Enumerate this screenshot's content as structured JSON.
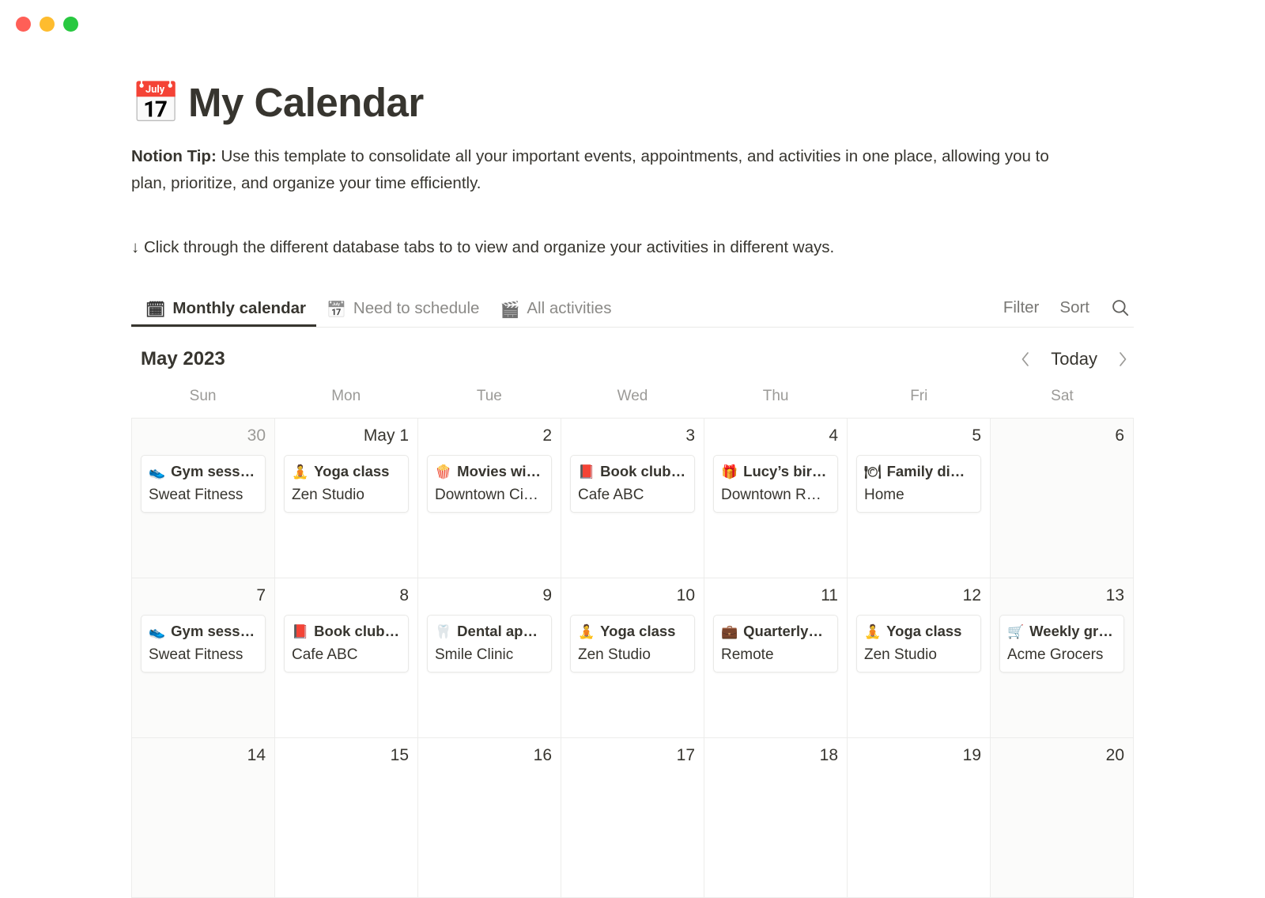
{
  "window": {
    "close_label": "close",
    "minimize_label": "minimize",
    "zoom_label": "zoom"
  },
  "header": {
    "emoji": "📅",
    "title": "My Calendar",
    "tip_label": "Notion Tip:",
    "tip_body": " Use this template to consolidate all your important events, appointments, and activities in one place, allowing you to plan, prioritize, and organize your time efficiently.",
    "hint": "↓ Click through the different database tabs to to view and organize your activities in different ways."
  },
  "tabs": [
    {
      "label": "Monthly calendar",
      "icon": "🗓",
      "active": true
    },
    {
      "label": "Need to schedule",
      "icon": "📅",
      "active": false
    },
    {
      "label": "All activities",
      "icon": "🎬",
      "active": false
    }
  ],
  "tools": {
    "filter_label": "Filter",
    "sort_label": "Sort",
    "search_icon": "search-icon"
  },
  "calendar": {
    "month_label": "May 2023",
    "prev_label": "previous",
    "today_label": "Today",
    "next_label": "next",
    "weekdays": [
      "Sun",
      "Mon",
      "Tue",
      "Wed",
      "Thu",
      "Fri",
      "Sat"
    ],
    "weeks": [
      [
        {
          "num": "30",
          "muted": true,
          "weekend": true,
          "events": [
            {
              "emoji": "👟",
              "title": "Gym sess…",
              "sub": "Sweat Fitness"
            }
          ]
        },
        {
          "num": "May 1",
          "muted": false,
          "weekend": false,
          "events": [
            {
              "emoji": "🧘",
              "title": "Yoga class",
              "sub": "Zen Studio"
            }
          ]
        },
        {
          "num": "2",
          "muted": false,
          "weekend": false,
          "events": [
            {
              "emoji": "🍿",
              "title": "Movies wi…",
              "sub": "Downtown Ci…"
            }
          ]
        },
        {
          "num": "3",
          "muted": false,
          "weekend": false,
          "events": [
            {
              "emoji": "📕",
              "title": "Book club…",
              "sub": "Cafe ABC"
            }
          ]
        },
        {
          "num": "4",
          "muted": false,
          "weekend": false,
          "events": [
            {
              "emoji": "🎁",
              "title": "Lucy’s bir…",
              "sub": "Downtown R…"
            }
          ]
        },
        {
          "num": "5",
          "muted": false,
          "weekend": false,
          "events": [
            {
              "emoji": "🍽",
              "title": "Family di…",
              "sub": "Home"
            }
          ]
        },
        {
          "num": "6",
          "muted": false,
          "weekend": true,
          "events": []
        }
      ],
      [
        {
          "num": "7",
          "muted": false,
          "weekend": true,
          "events": [
            {
              "emoji": "👟",
              "title": "Gym sess…",
              "sub": "Sweat Fitness"
            }
          ]
        },
        {
          "num": "8",
          "muted": false,
          "weekend": false,
          "events": [
            {
              "emoji": "📕",
              "title": "Book club…",
              "sub": "Cafe ABC"
            }
          ]
        },
        {
          "num": "9",
          "muted": false,
          "weekend": false,
          "events": [
            {
              "emoji": "🦷",
              "title": "Dental ap…",
              "sub": "Smile Clinic"
            }
          ]
        },
        {
          "num": "10",
          "muted": false,
          "weekend": false,
          "events": [
            {
              "emoji": "🧘",
              "title": "Yoga class",
              "sub": "Zen Studio"
            }
          ]
        },
        {
          "num": "11",
          "muted": false,
          "weekend": false,
          "events": [
            {
              "emoji": "💼",
              "title": "Quarterly…",
              "sub": "Remote"
            }
          ]
        },
        {
          "num": "12",
          "muted": false,
          "weekend": false,
          "events": [
            {
              "emoji": "🧘",
              "title": "Yoga class",
              "sub": "Zen Studio"
            }
          ]
        },
        {
          "num": "13",
          "muted": false,
          "weekend": true,
          "events": [
            {
              "emoji": "🛒",
              "title": "Weekly gr…",
              "sub": "Acme Grocers"
            }
          ]
        }
      ],
      [
        {
          "num": "14",
          "muted": false,
          "weekend": true,
          "events": []
        },
        {
          "num": "15",
          "muted": false,
          "weekend": false,
          "events": []
        },
        {
          "num": "16",
          "muted": false,
          "weekend": false,
          "events": []
        },
        {
          "num": "17",
          "muted": false,
          "weekend": false,
          "events": []
        },
        {
          "num": "18",
          "muted": false,
          "weekend": false,
          "events": []
        },
        {
          "num": "19",
          "muted": false,
          "weekend": false,
          "events": []
        },
        {
          "num": "20",
          "muted": false,
          "weekend": true,
          "events": []
        }
      ]
    ]
  },
  "colors": {
    "text": "#37352f",
    "muted": "#9b9a97",
    "border": "#ececeb",
    "weekend_bg": "#fbfbfa",
    "traffic_red": "#ff5f57",
    "traffic_yellow": "#febc2e",
    "traffic_green": "#28c840"
  }
}
